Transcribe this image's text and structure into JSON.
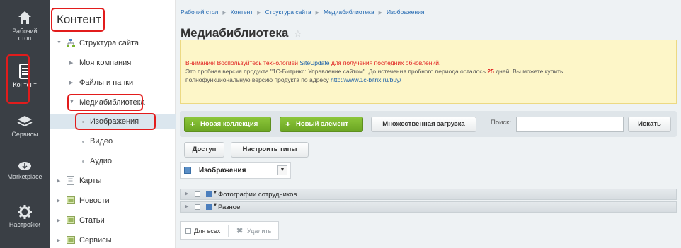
{
  "rail": {
    "items": [
      {
        "label_line1": "Рабочий",
        "label_line2": "стол",
        "icon": "home-icon"
      },
      {
        "label_line1": "Контент",
        "label_line2": "",
        "icon": "document-icon"
      },
      {
        "label_line1": "Сервисы",
        "label_line2": "",
        "icon": "layers-icon"
      },
      {
        "label_line1": "Marketplace",
        "label_line2": "",
        "icon": "cloud-download-icon"
      },
      {
        "label_line1": "Настройки",
        "label_line2": "",
        "icon": "gear-icon"
      }
    ]
  },
  "tree": {
    "title": "Контент",
    "items": [
      {
        "label": "Структура сайта",
        "icon": "sitemap-icon"
      },
      {
        "label": "Моя компания"
      },
      {
        "label": "Файлы и папки"
      },
      {
        "label": "Медиабиблиотека"
      },
      {
        "label": "Изображения"
      },
      {
        "label": "Видео"
      },
      {
        "label": "Аудио"
      },
      {
        "label": "Карты",
        "icon": "page-icon"
      },
      {
        "label": "Новости",
        "icon": "folder-icon"
      },
      {
        "label": "Статьи",
        "icon": "folder-icon"
      },
      {
        "label": "Сервисы",
        "icon": "folder-icon"
      }
    ]
  },
  "breadcrumbs": [
    "Рабочий стол",
    "Контент",
    "Структура сайта",
    "Медиабиблиотека",
    "Изображения"
  ],
  "page": {
    "title": "Медиабиблиотека",
    "star": "☆"
  },
  "notice": {
    "l1_pre": "Внимание! Воспользуйтесь технологией ",
    "l1_link": "SiteUpdate",
    "l1_post": " для получения последних обновлений.",
    "l2_pre": "Это пробная версия продукта \"1С-Битрикс: Управление сайтом\". До истечения пробного периода осталось ",
    "l2_days": "25",
    "l2_post": " дней. Вы можете купить",
    "l3_pre": "полнофункциональную версию продукта по адресу ",
    "l3_link": "http://www.1c-bitrix.ru/buy/"
  },
  "toolbar": {
    "new_collection": "Новая коллекция",
    "new_element": "Новый элемент",
    "bulk_upload": "Множественная загрузка",
    "search_label": "Поиск:",
    "search_value": "",
    "search_button": "Искать"
  },
  "actions": {
    "access": "Доступ",
    "configure_types": "Настроить типы"
  },
  "filter": {
    "selected": "Изображения"
  },
  "collections": [
    {
      "label": "Фотографии сотрудников"
    },
    {
      "label": "Разное"
    }
  ],
  "bottom": {
    "for_all": "Для всех",
    "delete": "Удалить"
  },
  "colors": {
    "rail_bg": "#3a3f45",
    "accent_green": "#7ab42c",
    "highlight_red": "#e21c1c",
    "link_blue": "#2067b0"
  }
}
